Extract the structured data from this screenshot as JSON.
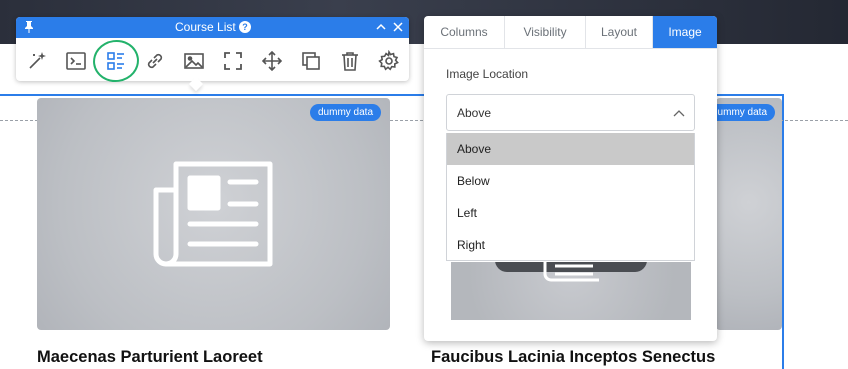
{
  "toolbar": {
    "title": "Course List",
    "help_label": "?",
    "tools": [
      {
        "icon": "magic-wand-icon"
      },
      {
        "icon": "code-icon"
      },
      {
        "icon": "list-layout-icon"
      },
      {
        "icon": "link-icon"
      },
      {
        "icon": "image-icon"
      },
      {
        "icon": "fullscreen-icon"
      },
      {
        "icon": "move-icon"
      },
      {
        "icon": "duplicate-icon"
      },
      {
        "icon": "trash-icon"
      },
      {
        "icon": "gear-icon"
      }
    ],
    "highlight_color": "#23b26b"
  },
  "panel": {
    "tabs": [
      {
        "label": "Columns",
        "active": false
      },
      {
        "label": "Visibility",
        "active": false
      },
      {
        "label": "Layout",
        "active": false
      },
      {
        "label": "Image",
        "active": true
      }
    ],
    "image_location": {
      "label": "Image Location",
      "value": "Above",
      "options": [
        "Above",
        "Below",
        "Left",
        "Right"
      ],
      "highlighted_option": "Above"
    }
  },
  "cards": [
    {
      "title": "Maecenas Parturient Laoreet",
      "badge": "dummy data",
      "image_icon": "newspaper-icon"
    },
    {
      "title": "Faucibus Lacinia Inceptos Senectus",
      "badge": "dummy data",
      "image_icon": "newspaper-icon"
    }
  ],
  "colors": {
    "accent": "#2b7de9",
    "selected_option_bg": "#c9c9c9",
    "placeholder_image": "#c3c5ca"
  }
}
